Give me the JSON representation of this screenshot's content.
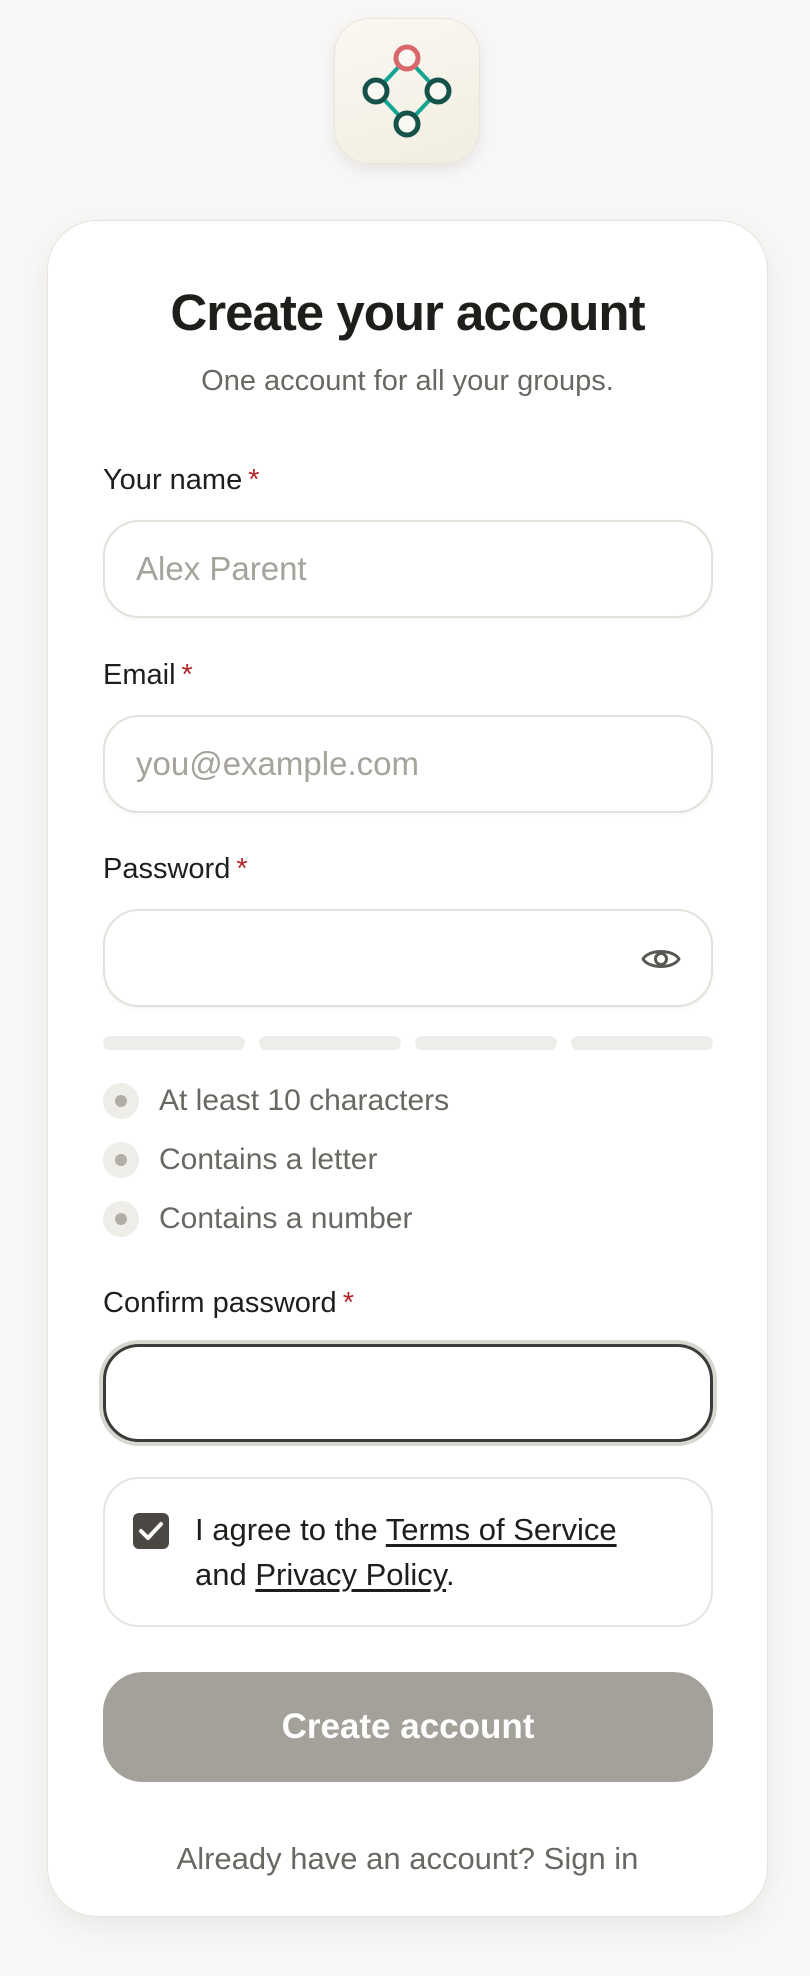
{
  "brand": {
    "logo_icon": "network-diamond-logo",
    "accent_color": "#0f8f7e",
    "highlight_color": "#d9686c"
  },
  "header": {
    "title": "Create your account",
    "subtitle": "One account for all your groups."
  },
  "form": {
    "name": {
      "label": "Your name",
      "required_mark": "*",
      "placeholder": "Alex Parent",
      "value": ""
    },
    "email": {
      "label": "Email",
      "required_mark": "*",
      "placeholder": "you@example.com",
      "value": ""
    },
    "password": {
      "label": "Password",
      "required_mark": "*",
      "value": "",
      "toggle_icon": "eye-icon"
    },
    "password_strength_segments": 4,
    "requirements": [
      {
        "text": "At least 10 characters",
        "met": false
      },
      {
        "text": "Contains a letter",
        "met": false
      },
      {
        "text": "Contains a number",
        "met": false
      }
    ],
    "confirm_password": {
      "label": "Confirm password",
      "required_mark": "*",
      "value": ""
    },
    "agreement": {
      "checked": true,
      "prefix": "I agree to the",
      "terms_link": "Terms of Service",
      "middle": "and",
      "privacy_link": "Privacy Policy",
      "suffix": "."
    },
    "submit_label": "Create account"
  },
  "footer": {
    "prompt": "Already have an account?",
    "signin_link": "Sign in"
  }
}
